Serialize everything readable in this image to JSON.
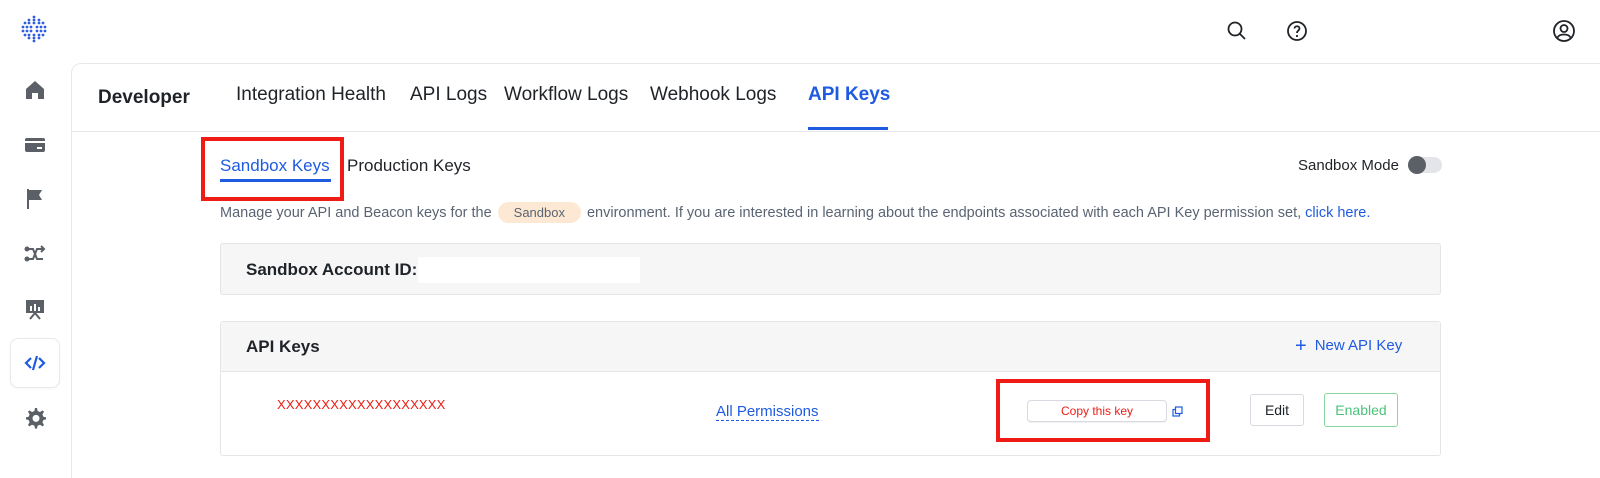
{
  "top_icons": {
    "search": "search-icon",
    "help": "help-icon",
    "account": "account-icon"
  },
  "sidebar": {
    "items": [
      {
        "icon": "home-icon"
      },
      {
        "icon": "card-icon"
      },
      {
        "icon": "flag-icon"
      },
      {
        "icon": "flow-icon"
      },
      {
        "icon": "presentation-icon"
      },
      {
        "icon": "code-icon",
        "active": true
      },
      {
        "icon": "gear-icon"
      }
    ]
  },
  "header": {
    "title": "Developer",
    "tabs": [
      "Integration Health",
      "API Logs",
      "Workflow Logs",
      "Webhook Logs",
      "API Keys"
    ],
    "active_tab": "API Keys"
  },
  "subtabs": {
    "items": [
      "Sandbox Keys",
      "Production Keys"
    ],
    "active": "Sandbox Keys"
  },
  "mode": {
    "label": "Sandbox Mode",
    "enabled": false
  },
  "description": {
    "before": "Manage your API and Beacon keys for the",
    "pill": "Sandbox",
    "after": "environment. If you are interested in learning about the endpoints associated with each API Key permission set,",
    "link": "click here."
  },
  "account": {
    "label": "Sandbox Account ID:",
    "value": ""
  },
  "api_keys": {
    "title": "API Keys",
    "new_button": "New API Key",
    "rows": [
      {
        "key": "XXXXXXXXXXXXXXXXXXX",
        "permissions": "All Permissions",
        "copy_label": "Copy this key",
        "edit_label": "Edit",
        "status": "Enabled"
      }
    ]
  },
  "colors": {
    "accent": "#1f5be0",
    "highlight": "#ee1c14",
    "success": "#4cc27a",
    "pill_bg": "#fde9d3"
  }
}
